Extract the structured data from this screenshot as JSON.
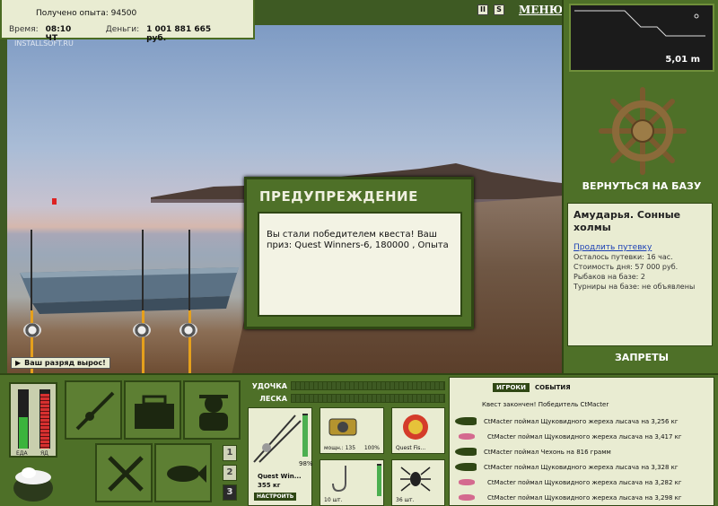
{
  "top_info": {
    "xp_label": "Получено опыта:",
    "xp_value": "94500",
    "time_label": "Время:",
    "time_value": "08:10 ЧТ",
    "money_label": "Деньги:",
    "money_value": "1 001 881 665 руб."
  },
  "watermark": "INSTALLSOFT.RU",
  "menu": {
    "pause_icon": "pause-icon",
    "sound_icon": "sound-icon",
    "label": "МЕНЮ"
  },
  "depth": {
    "value": "5,01 m"
  },
  "right_panel": {
    "base_button": "ВЕРНУТЬСЯ НА БАЗУ",
    "location_title": "Амударья. Сонные холмы",
    "extend_link": "Продлить путевку",
    "lines": [
      "Осталось путевки: 16 час.",
      "Стоимость дня: 57 000 руб.",
      "Рыбаков на базе: 2",
      "Турниры на базе: не объявлены"
    ],
    "bans_button": "ЗАПРЕТЫ"
  },
  "dialog": {
    "title": "ПРЕДУПРЕЖДЕНИЕ",
    "message": "Вы стали победителем квеста! Ваш приз: Quest Winners-6, 180000 , Опыта"
  },
  "grade_badge": "Ваш разряд вырос!",
  "meters": {
    "food_label": "ЕДА",
    "poison_label": "ЯД",
    "food_level": 0.55,
    "poison_level": 0.95
  },
  "tool_pages": [
    "1",
    "2",
    "3"
  ],
  "gear": {
    "rod_label": "УДОЧКА",
    "line_label": "ЛЕСКА",
    "rod_name": "Quest Win...",
    "rod_weight": "355 кг",
    "rod_percent": "98%",
    "setup_button": "НАСТРОИТЬ",
    "reel_caption": "мощн.: 135",
    "reel_percent": "100%",
    "lure_caption": "Quest Fis...",
    "hook_caption": "10 шт.",
    "bait_caption": "36 шт."
  },
  "events": {
    "tab_players": "ИГРОКИ",
    "tab_events": "СОБЫТИЯ",
    "quest_line": "Квест закончен! Победитель CtMacter",
    "items": [
      {
        "icon": "fish",
        "text": "CtMacter поймал Щуковидного жереха лысача на 3,256 кг"
      },
      {
        "icon": "lure",
        "text": "CtMacter поймал Щуковидного жереха лысача на 3,417 кг"
      },
      {
        "icon": "fish",
        "text": "CtMacter поймал Чехонь на 816 грамм"
      },
      {
        "icon": "fish",
        "text": "CtMacter поймал Щуковидного жереха лысача на 3,328 кг"
      },
      {
        "icon": "lure",
        "text": "CtMacter поймал Щуковидного жереха лысача на 3,282 кг"
      },
      {
        "icon": "lure",
        "text": "CtMacter поймал Щуковидного жереха лысача на 3,298 кг"
      }
    ]
  }
}
